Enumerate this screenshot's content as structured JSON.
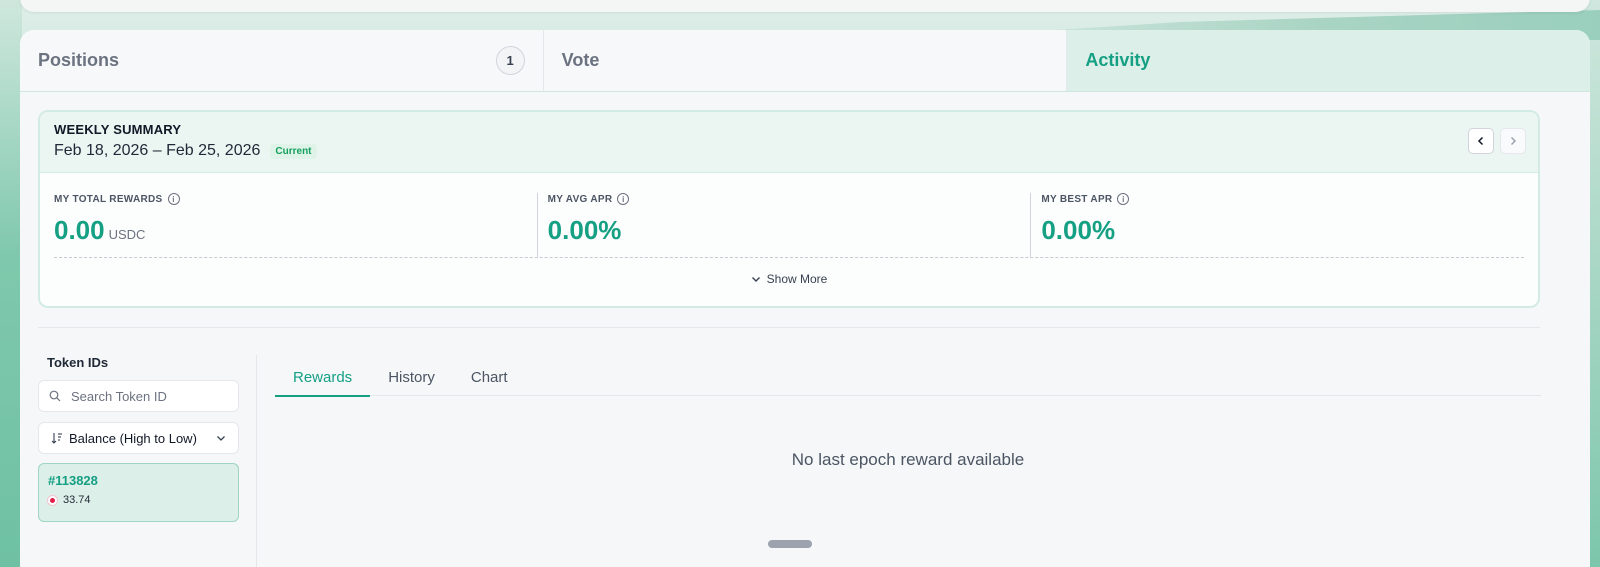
{
  "tabs": {
    "positions": {
      "label": "Positions",
      "count": "1"
    },
    "vote": {
      "label": "Vote"
    },
    "activity": {
      "label": "Activity"
    }
  },
  "summary": {
    "title": "WEEKLY SUMMARY",
    "range": "Feb 18, 2026 – Feb 25, 2026",
    "badge": "Current",
    "stats": [
      {
        "label": "MY TOTAL REWARDS",
        "value": "0.00",
        "unit": "USDC"
      },
      {
        "label": "MY AVG APR",
        "value": "0.00%"
      },
      {
        "label": "MY BEST APR",
        "value": "0.00%"
      }
    ],
    "show_more": "Show More"
  },
  "sidebar": {
    "title": "Token IDs",
    "search_placeholder": "Search Token ID",
    "sort_label": "Balance (High to Low)",
    "tokens": [
      {
        "id": "#113828",
        "balance": "33.74"
      }
    ]
  },
  "panel": {
    "tabs": [
      "Rewards",
      "History",
      "Chart"
    ],
    "active_tab": "Rewards",
    "empty_message": "No last epoch reward available"
  },
  "colors": {
    "accent": "#15a084",
    "badge": "#15a05d"
  }
}
